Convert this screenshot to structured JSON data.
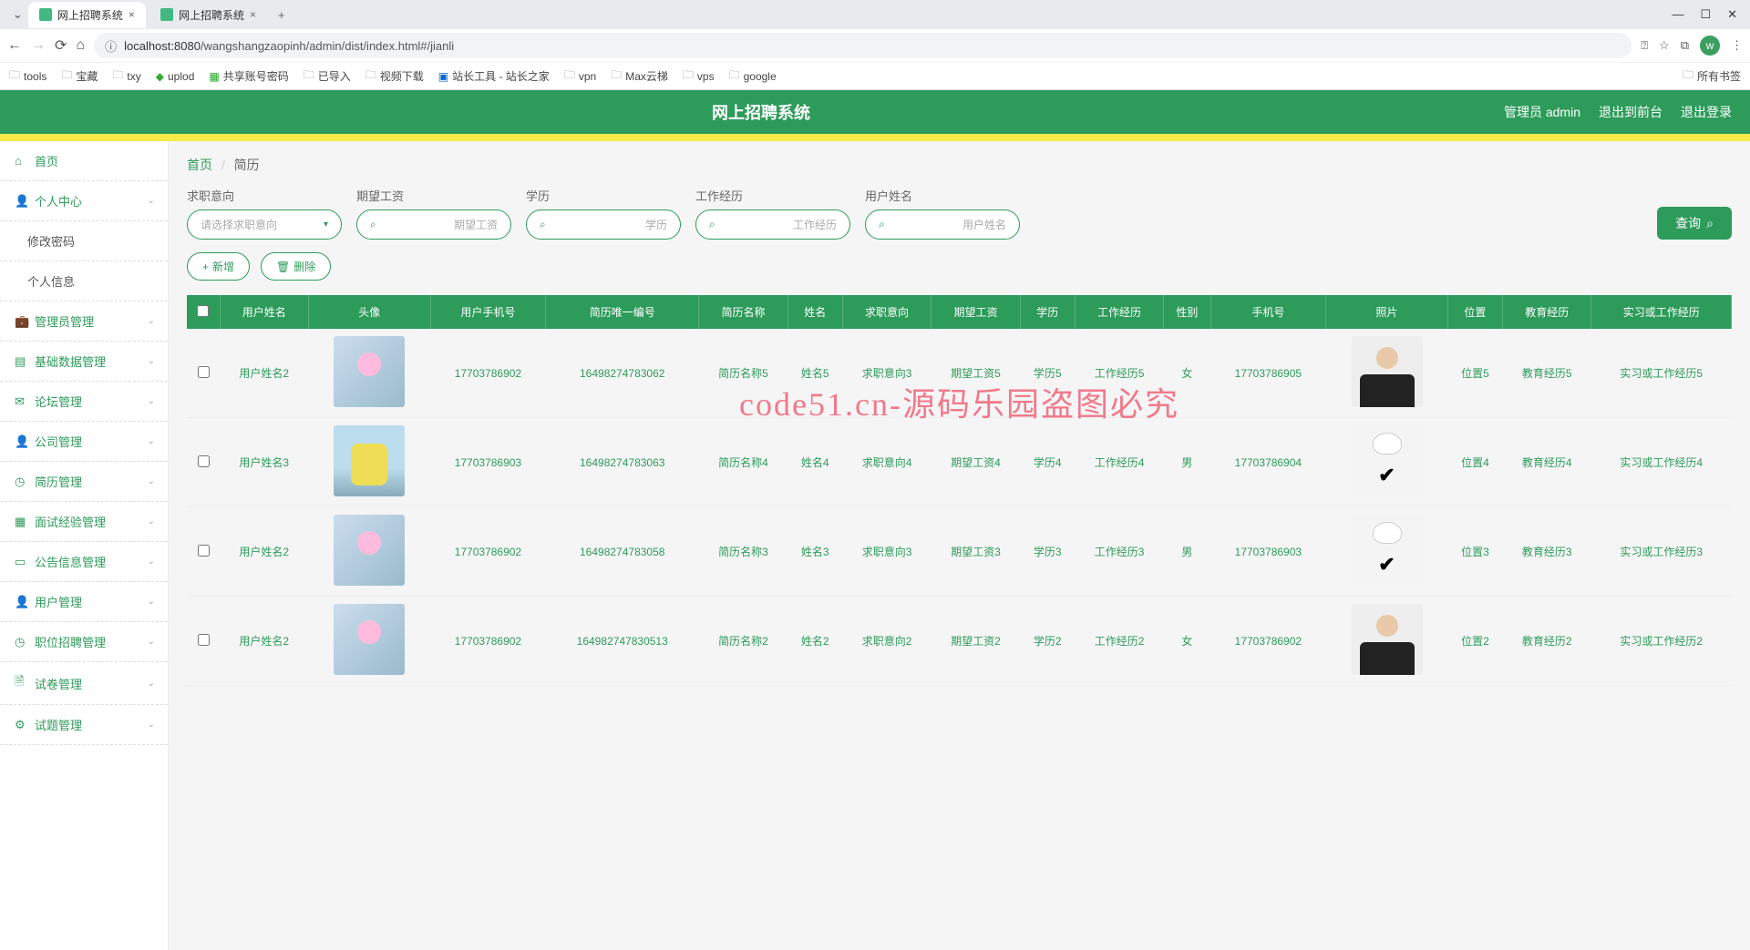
{
  "browser": {
    "tabs": [
      {
        "title": "网上招聘系统",
        "active": true
      },
      {
        "title": "网上招聘系统",
        "active": false
      }
    ],
    "url_host": "localhost:8080",
    "url_path": "/wangshangzaopinh/admin/dist/index.html#/jianli",
    "bookmarks": [
      "tools",
      "宝藏",
      "txy",
      "uplod",
      "共享账号密码",
      "已导入",
      "视频下载",
      "站长工具 - 站长之家",
      "vpn",
      "Max云梯",
      "vps",
      "google"
    ],
    "bookmark_right": "所有书签"
  },
  "header": {
    "title": "网上招聘系统",
    "user": "管理员 admin",
    "action_front": "退出到前台",
    "action_logout": "退出登录"
  },
  "sidebar": {
    "items": [
      {
        "label": "首页",
        "icon": "home",
        "expandable": false
      },
      {
        "label": "个人中心",
        "icon": "user",
        "expandable": true
      },
      {
        "label": "修改密码",
        "icon": "",
        "sub": true
      },
      {
        "label": "个人信息",
        "icon": "",
        "sub": true
      },
      {
        "label": "管理员管理",
        "icon": "briefcase",
        "expandable": true
      },
      {
        "label": "基础数据管理",
        "icon": "data",
        "expandable": true
      },
      {
        "label": "论坛管理",
        "icon": "mail",
        "expandable": true
      },
      {
        "label": "公司管理",
        "icon": "user",
        "expandable": true
      },
      {
        "label": "简历管理",
        "icon": "clock",
        "expandable": true
      },
      {
        "label": "面试经验管理",
        "icon": "grid",
        "expandable": true
      },
      {
        "label": "公告信息管理",
        "icon": "msg",
        "expandable": true
      },
      {
        "label": "用户管理",
        "icon": "user",
        "expandable": true
      },
      {
        "label": "职位招聘管理",
        "icon": "clock",
        "expandable": true
      },
      {
        "label": "试卷管理",
        "icon": "doc",
        "expandable": true
      },
      {
        "label": "试题管理",
        "icon": "gear",
        "expandable": true
      }
    ]
  },
  "breadcrumb": {
    "home": "首页",
    "current": "简历"
  },
  "filters": {
    "f1_label": "求职意向",
    "f1_placeholder": "请选择求职意向",
    "f2_label": "期望工资",
    "f2_placeholder": "期望工资",
    "f3_label": "学历",
    "f3_placeholder": "学历",
    "f4_label": "工作经历",
    "f4_placeholder": "工作经历",
    "f5_label": "用户姓名",
    "f5_placeholder": "用户姓名",
    "query": "查询"
  },
  "actions": {
    "add": "新增",
    "delete": "删除"
  },
  "table": {
    "headers": [
      "",
      "用户姓名",
      "头像",
      "用户手机号",
      "简历唯一编号",
      "简历名称",
      "姓名",
      "求职意向",
      "期望工资",
      "学历",
      "工作经历",
      "性别",
      "手机号",
      "照片",
      "位置",
      "教育经历",
      "实习或工作经历"
    ],
    "rows": [
      {
        "username": "用户姓名2",
        "phone": "17703786902",
        "uid": "16498274783062",
        "resume": "简历名称5",
        "name": "姓名5",
        "intent": "求职意向3",
        "salary": "期望工资5",
        "edu": "学历5",
        "exp": "工作经历5",
        "gender": "女",
        "mobile": "17703786905",
        "loc": "位置5",
        "eduExp": "教育经历5",
        "workExp": "实习或工作经历5",
        "avatar": "person",
        "photo": "suit"
      },
      {
        "username": "用户姓名3",
        "phone": "17703786903",
        "uid": "16498274783063",
        "resume": "简历名称4",
        "name": "姓名4",
        "intent": "求职意向4",
        "salary": "期望工资4",
        "edu": "学历4",
        "exp": "工作经历4",
        "gender": "男",
        "mobile": "17703786904",
        "loc": "位置4",
        "eduExp": "教育经历4",
        "workExp": "实习或工作经历4",
        "avatar": "yellow",
        "photo": "mask"
      },
      {
        "username": "用户姓名2",
        "phone": "17703786902",
        "uid": "16498274783058",
        "resume": "简历名称3",
        "name": "姓名3",
        "intent": "求职意向3",
        "salary": "期望工资3",
        "edu": "学历3",
        "exp": "工作经历3",
        "gender": "男",
        "mobile": "17703786903",
        "loc": "位置3",
        "eduExp": "教育经历3",
        "workExp": "实习或工作经历3",
        "avatar": "person",
        "photo": "mask"
      },
      {
        "username": "用户姓名2",
        "phone": "17703786902",
        "uid": "164982747830513",
        "resume": "简历名称2",
        "name": "姓名2",
        "intent": "求职意向2",
        "salary": "期望工资2",
        "edu": "学历2",
        "exp": "工作经历2",
        "gender": "女",
        "mobile": "17703786902",
        "loc": "位置2",
        "eduExp": "教育经历2",
        "workExp": "实习或工作经历2",
        "avatar": "person",
        "photo": "suit"
      }
    ]
  },
  "watermark": {
    "small": "code51.cn",
    "big": "code51.cn-源码乐园盗图必究"
  }
}
